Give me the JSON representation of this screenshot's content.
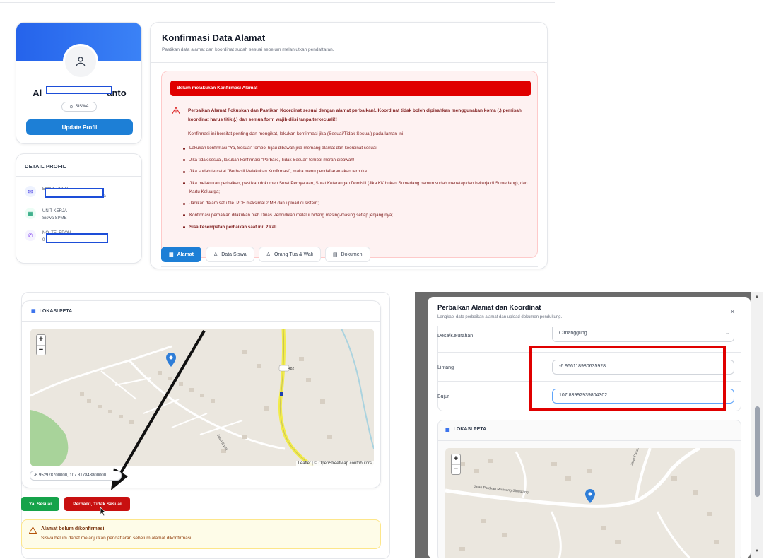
{
  "profile": {
    "name_visible": "Al",
    "name_suffix": "anto",
    "badge": "SISWA",
    "update_button": "Update Profil"
  },
  "detail": {
    "title": "DETAIL PROFIL",
    "email_label": "EMAIL USER",
    "email_suffix": "wa",
    "unit_label": "UNIT KERJA",
    "unit_value": "Siswa SPMB",
    "phone_label": "NO. TELEPON",
    "phone_prefix": "0"
  },
  "main": {
    "title": "Konfirmasi Data Alamat",
    "subtitle": "Pastikan data alamat dan koordinat sudah sesuai sebelum melanjutkan pendaftaran."
  },
  "alert": {
    "header": "Belum melakukan Konfirmasi Alamat",
    "bold_text": "Perbaikan Alamat Fokuskan dan Pastikan Koordinat sesuai dengan alamat perbaikan!, Koordinat tidak boleh dipisahkan menggunakan koma (,) pemisah koordinat harus titik (.) dan semua form wajib diisi tanpa terkecuali!!",
    "intro": "Konfirmasi ini bersifat penting dan mengikat, lakukan konfirmasi jika (Sesuai/Tidak Sesuai) pada laman ini.",
    "items": [
      "Lakukan konfirmasi \"Ya, Sesuai\" tombol hijau dibawah jika memang alamat dan koordinat sesuai;",
      "Jika tidak sesuai, lakukan konfirmasi \"Perbaiki, Tidak Sesuai\" tombol merah dibawah!",
      "Jika sudah tercatat \"Berhasil Melakukan Konfirmasi\", maka menu pendaftaran akan terbuka.",
      "Jika melakukan perbaikan, pastikan dokumen Surat Pernyataan, Surat Keterangan Domisili (Jika KK bukan Sumedang namun sudah menetap dan bekerja di Sumedang), dan Kartu Keluarga;",
      "Jadikan dalam satu file .PDF maksimal 2 MB dan upload di sistem;",
      "Konfirmasi perbaikan dilakukan oleh Dinas Pendidikan melalui bidang masing-masing setiap jenjang nya;",
      "Sisa kesempatan perbaikan saat ini: 2 kali."
    ]
  },
  "tabs": [
    "Alamat",
    "Data Siswa",
    "Orang Tua & Wali",
    "Dokumen"
  ],
  "map": {
    "section_title": "LOKASI PETA",
    "zoom_in": "+",
    "zoom_out": "−",
    "attribution": "Leaflet | © OpenStreetMap contributors",
    "road_label": "482",
    "coords": "-6.952978700000, 107.817843800000",
    "road_name": "Jalan Buntil"
  },
  "buttons": {
    "yes": "Ya, Sesuai",
    "fix": "Perbaiki, Tidak Sesuai"
  },
  "warning": {
    "title": "Alamat belum dikonfirmasi.",
    "text": "Siswa belum dapat melanjutkan pendaftaran sebelum alamat dikonfirmasi."
  },
  "modal": {
    "title": "Perbaikan Alamat dan Koordinat",
    "subtitle": "Lengkapi data perbaikan alamat dan upload dokumen pendukung.",
    "close": "×",
    "desa_label": "Desa/Kelurahan",
    "desa_value": "Cimanggung",
    "lat_label": "Lintang",
    "lat_value": "-6.966118980635928",
    "lng_label": "Bujur",
    "lng_value": "107.83992939804302",
    "map_title": "LOKASI PETA",
    "road1": "Jalan Parakan Muncang-Sindulang",
    "road2": "Jalan Parakan Muncang"
  }
}
